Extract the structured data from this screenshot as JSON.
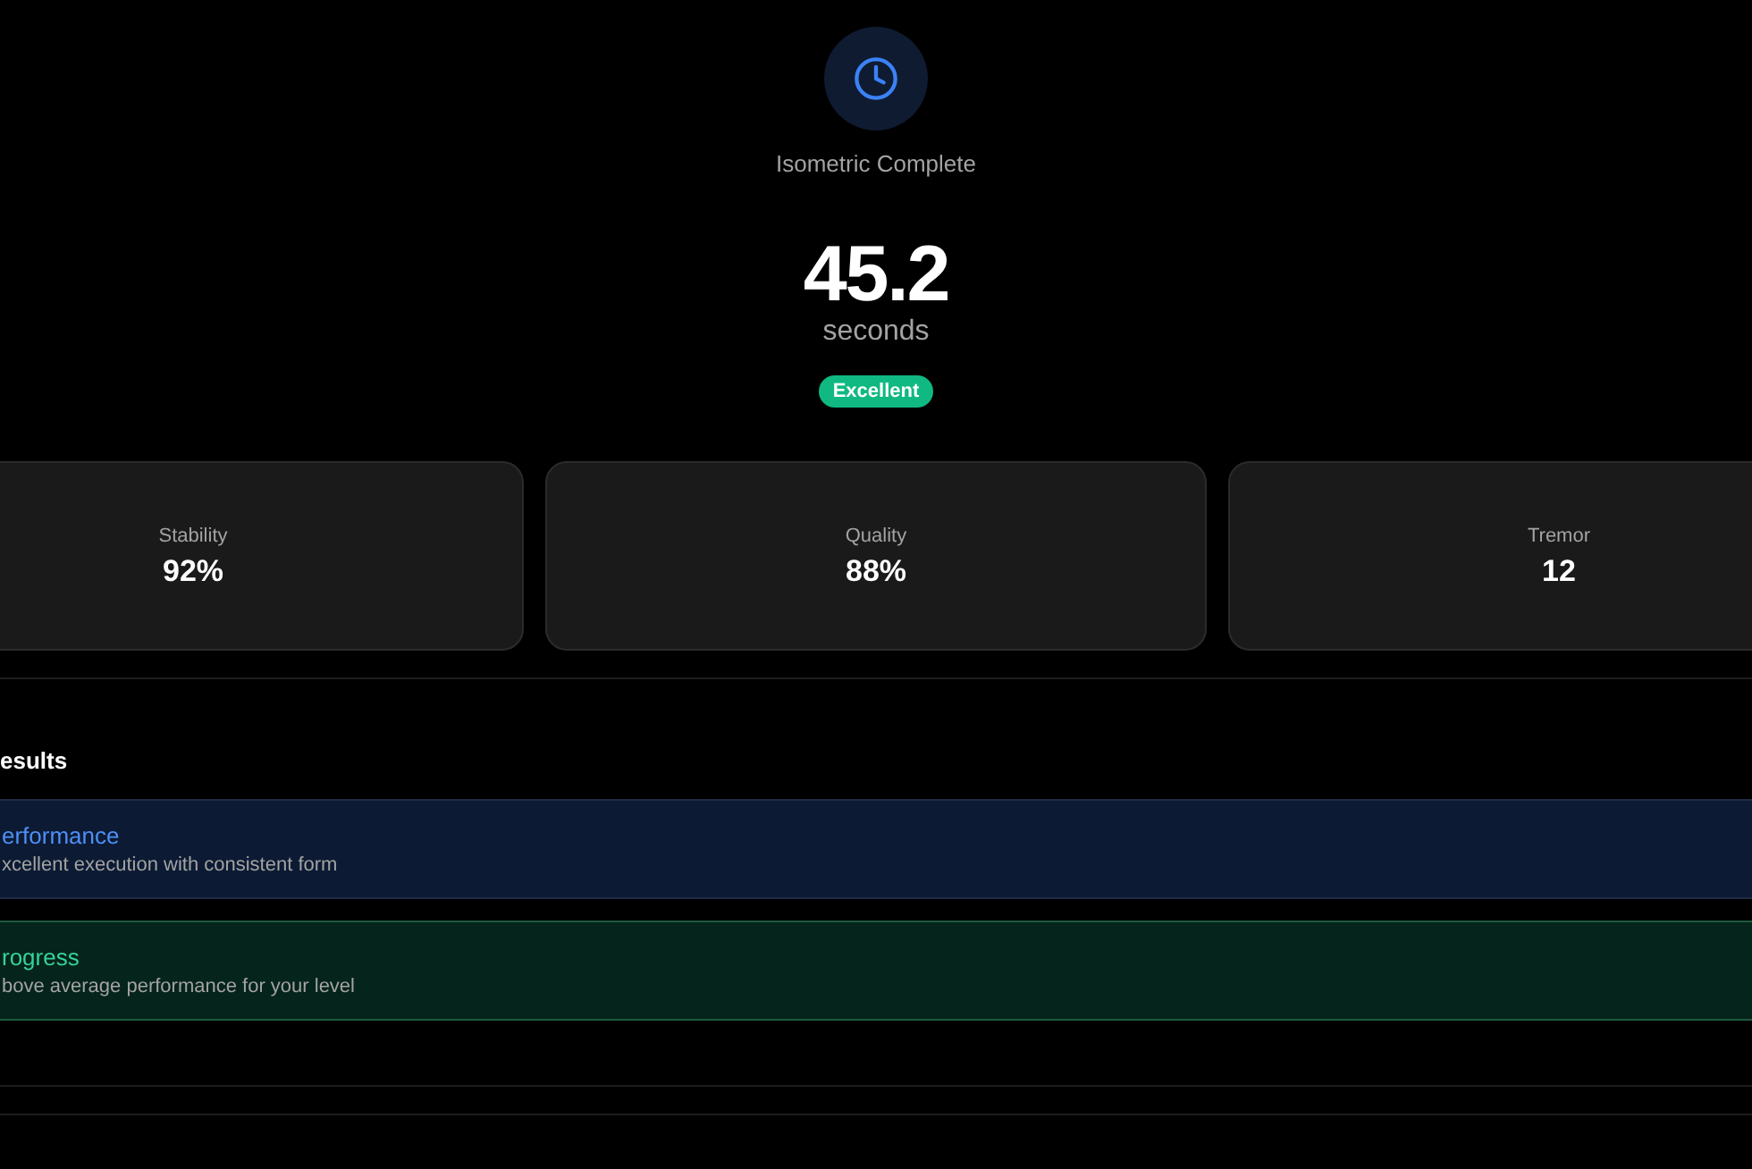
{
  "header": {
    "title": "Isometric Complete",
    "value": "45.2",
    "unit": "seconds",
    "badge": {
      "label": "Excellent",
      "kind": "success"
    }
  },
  "metrics": [
    {
      "label": "Stability",
      "value": "92%"
    },
    {
      "label": "Quality",
      "value": "88%"
    },
    {
      "label": "Tremor",
      "value": "12"
    }
  ],
  "results": {
    "title": "esults",
    "items": [
      {
        "kind": "info",
        "title": "erformance",
        "description": "xcellent execution with consistent form"
      },
      {
        "kind": "success",
        "title": "rogress",
        "description": "bove average performance for your level"
      }
    ]
  }
}
